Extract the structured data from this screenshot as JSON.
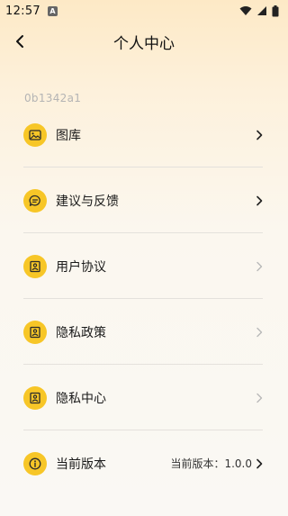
{
  "status_bar": {
    "time": "12:57",
    "notification_badge": "A"
  },
  "header": {
    "title": "个人中心"
  },
  "user": {
    "id": "0b1342a1"
  },
  "menu": [
    {
      "label": "图库",
      "icon": "gallery-icon",
      "chevron": "dark"
    },
    {
      "label": "建议与反馈",
      "icon": "feedback-icon",
      "chevron": "dark"
    },
    {
      "label": "用户协议",
      "icon": "document-icon",
      "chevron": "light"
    },
    {
      "label": "隐私政策",
      "icon": "document-icon",
      "chevron": "light"
    },
    {
      "label": "隐私中心",
      "icon": "document-icon",
      "chevron": "light"
    },
    {
      "label": "当前版本",
      "icon": "info-icon",
      "value": "当前版本：1.0.0",
      "chevron": "dark"
    }
  ],
  "colors": {
    "accent": "#f7c627",
    "icon_stroke": "#2b2b2b",
    "chevron_dark": "#222222",
    "chevron_light": "#b8b8b8"
  }
}
